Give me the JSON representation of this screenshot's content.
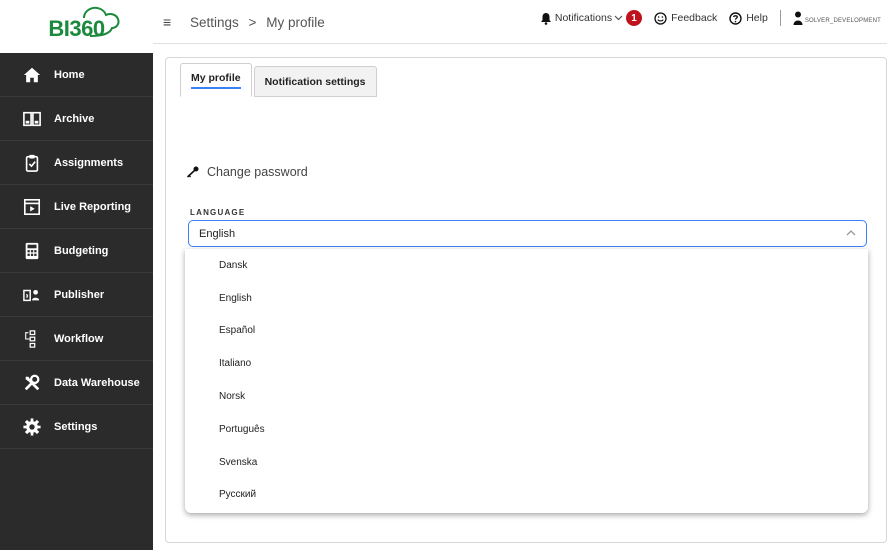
{
  "logo": {
    "text": "BI360"
  },
  "sidebar": {
    "items": [
      {
        "label": "Home",
        "icon": "home-icon"
      },
      {
        "label": "Archive",
        "icon": "archive-icon"
      },
      {
        "label": "Assignments",
        "icon": "clipboard-icon"
      },
      {
        "label": "Live Reporting",
        "icon": "live-reporting-icon"
      },
      {
        "label": "Budgeting",
        "icon": "calculator-icon"
      },
      {
        "label": "Publisher",
        "icon": "publisher-icon"
      },
      {
        "label": "Workflow",
        "icon": "workflow-icon"
      },
      {
        "label": "Data Warehouse",
        "icon": "tools-icon"
      },
      {
        "label": "Settings",
        "icon": "gear-icon"
      }
    ]
  },
  "topbar": {
    "menu_icon": "≡",
    "breadcrumb": [
      "Settings",
      ">",
      "My profile"
    ],
    "notifications_label": "Notifications",
    "notifications_count": "1",
    "feedback_label": "Feedback",
    "help_label": "Help",
    "user_name": "SOLVER_DEVELOPMENT"
  },
  "tabs": [
    {
      "label": "My profile",
      "active": true
    },
    {
      "label": "Notification settings",
      "active": false
    }
  ],
  "profile": {
    "change_password_label": "Change password",
    "language_label": "LANGUAGE",
    "language_value": "English",
    "language_options": [
      "Dansk",
      "English",
      "Español",
      "Italiano",
      "Norsk",
      "Português",
      "Svenska",
      "Русский"
    ]
  },
  "colors": {
    "sidebar_bg": "#2b2b2b",
    "brand_green": "#1b8a3d",
    "focus_blue": "#3b82f6",
    "badge_red": "#c0121c"
  }
}
